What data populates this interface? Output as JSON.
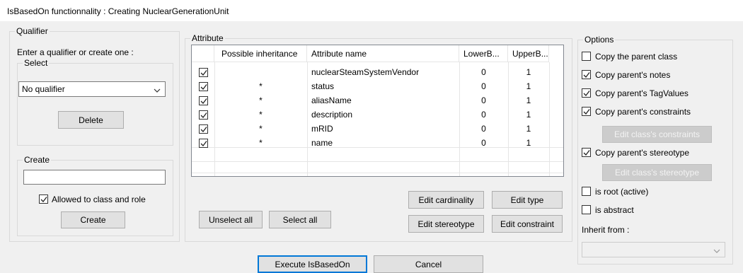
{
  "window": {
    "title": "IsBasedOn functionnality : Creating NuclearGenerationUnit"
  },
  "qualifier": {
    "group_label": "Qualifier",
    "instruction": "Enter a qualifier or create one :",
    "select_group_label": "Select",
    "select_value": "No qualifier",
    "delete_label": "Delete",
    "create_group_label": "Create",
    "create_input_value": "",
    "allowed_checkbox_label": "Allowed to class and role",
    "allowed_checked": true,
    "create_button_label": "Create"
  },
  "attribute": {
    "group_label": "Attribute",
    "columns": [
      "Possible inheritance",
      "Attribute name",
      "LowerB...",
      "UpperB..."
    ],
    "rows": [
      {
        "checked": true,
        "inheritance": "",
        "name": "nuclearSteamSystemVendor",
        "lower": "0",
        "upper": "1"
      },
      {
        "checked": true,
        "inheritance": "*",
        "name": "status",
        "lower": "0",
        "upper": "1"
      },
      {
        "checked": true,
        "inheritance": "*",
        "name": "aliasName",
        "lower": "0",
        "upper": "1"
      },
      {
        "checked": true,
        "inheritance": "*",
        "name": "description",
        "lower": "0",
        "upper": "1"
      },
      {
        "checked": true,
        "inheritance": "*",
        "name": "mRID",
        "lower": "0",
        "upper": "1"
      },
      {
        "checked": true,
        "inheritance": "*",
        "name": "name",
        "lower": "0",
        "upper": "1"
      }
    ],
    "unselect_all_label": "Unselect all",
    "select_all_label": "Select all",
    "edit_cardinality_label": "Edit cardinality",
    "edit_type_label": "Edit type",
    "edit_stereotype_label": "Edit stereotype",
    "edit_constraint_label": "Edit constraint"
  },
  "options": {
    "group_label": "Options",
    "copy_parent_class": {
      "label": "Copy the parent class",
      "checked": false
    },
    "copy_notes": {
      "label": "Copy parent's notes",
      "checked": true
    },
    "copy_tagvalues": {
      "label": "Copy parent's TagValues",
      "checked": true
    },
    "copy_constraints": {
      "label": "Copy parent's constraints",
      "checked": true
    },
    "edit_class_constraints_label": "Edit class's constraints",
    "copy_stereotype": {
      "label": "Copy parent's stereotype",
      "checked": true
    },
    "edit_class_stereotype_label": "Edit class's stereotype",
    "is_root": {
      "label": "is root (active)",
      "checked": false
    },
    "is_abstract": {
      "label": "is abstract",
      "checked": false
    },
    "inherit_from_label": "Inherit from :",
    "inherit_from_value": ""
  },
  "footer": {
    "execute_label": "Execute IsBasedOn",
    "cancel_label": "Cancel"
  },
  "icons": {
    "check": "check-mark-icon",
    "dropdown": "chevron-down-icon"
  }
}
